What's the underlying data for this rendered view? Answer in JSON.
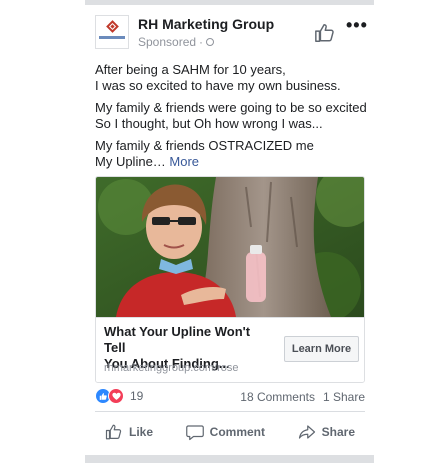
{
  "post": {
    "page_name": "RH Marketing Group",
    "sponsored_label": "Sponsored",
    "separator": "·",
    "more_menu": "•••",
    "text_block_1_line_1": "After being a SAHM for 10 years,",
    "text_block_1_line_2": "I was so excited to have my own business.",
    "text_block_2_line_1": "My family & friends were going to be so excited",
    "text_block_2_line_2": "So I thought, but Oh how wrong I was...",
    "text_block_3_line_1": "My family & friends OSTRACIZED me",
    "text_block_3_line_2": "My Upline…",
    "see_more": "More"
  },
  "ad": {
    "headline_line_1": "What Your Upline Won't Tell",
    "headline_line_2": "You About Finding...",
    "domain": "rhmarketinggroup.com/rose",
    "cta_label": "Learn More"
  },
  "engagement": {
    "reaction_count": "19",
    "comments": "18 Comments",
    "shares": "1 Share",
    "reaction_icons": [
      "like-reaction",
      "love-reaction"
    ]
  },
  "actions": {
    "like_label": "Like",
    "comment_label": "Comment",
    "share_label": "Share"
  },
  "colors": {
    "link": "#385898",
    "like_blue": "#2d88ff",
    "love_red": "#f33e58",
    "logo_red": "#c0392b"
  }
}
